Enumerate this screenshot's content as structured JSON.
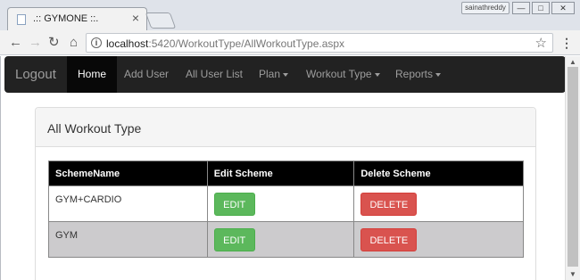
{
  "browser": {
    "tab_title": ".:: GYMONE ::.",
    "tab_close": "×",
    "profile_name": "sainathreddy",
    "url_host": "localhost",
    "url_path": ":5420/WorkoutType/AllWorkoutType.aspx"
  },
  "navbar": {
    "brand": "Logout",
    "items": [
      {
        "label": "Home",
        "active": true
      },
      {
        "label": "Add User",
        "active": false
      },
      {
        "label": "All User List",
        "active": false
      },
      {
        "label": "Plan",
        "active": false,
        "dropdown": true
      },
      {
        "label": "Workout Type",
        "active": false,
        "dropdown": true
      },
      {
        "label": "Reports",
        "active": false,
        "dropdown": true
      }
    ]
  },
  "panel": {
    "title": "All Workout Type"
  },
  "table": {
    "headers": [
      "SchemeName",
      "Edit Scheme",
      "Delete Scheme"
    ],
    "rows": [
      {
        "name": "GYM+CARDIO",
        "edit": "EDIT",
        "delete": "DELETE"
      },
      {
        "name": "GYM",
        "edit": "EDIT",
        "delete": "DELETE"
      }
    ]
  },
  "colors": {
    "navbar_bg": "#222222",
    "edit_button": "#5cb85c",
    "delete_button": "#d9534f",
    "table_header_bg": "#000000",
    "alt_row_bg": "#cccbcd"
  }
}
